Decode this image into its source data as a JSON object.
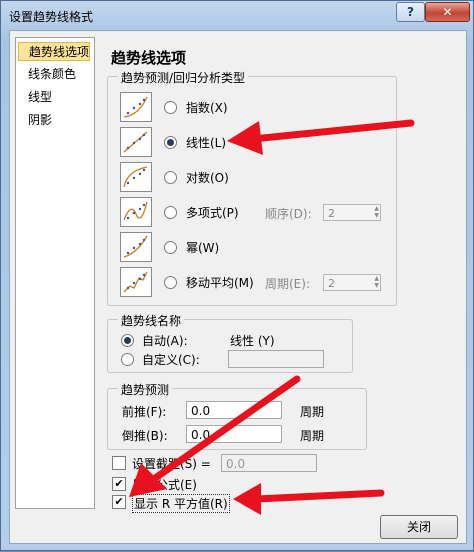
{
  "window": {
    "title": "设置趋势线格式",
    "help_label": "?",
    "close_label": "✕"
  },
  "nav": {
    "items": [
      "趋势线选项",
      "线条颜色",
      "线型",
      "阴影"
    ]
  },
  "panel": {
    "heading": "趋势线选项",
    "type_group": {
      "title": "趋势预测/回归分析类型",
      "options": [
        {
          "label": "指数(X)",
          "selected": false
        },
        {
          "label": "线性(L)",
          "selected": true
        },
        {
          "label": "对数(O)",
          "selected": false
        },
        {
          "label": "多项式(P)",
          "selected": false
        },
        {
          "label": "幂(W)",
          "selected": false
        },
        {
          "label": "移动平均(M)",
          "selected": false
        }
      ],
      "order_label": "顺序(D):",
      "order_value": "2",
      "period_label": "周期(E):",
      "period_value": "2"
    },
    "name_group": {
      "title": "趋势线名称",
      "auto_label": "自动(A):",
      "auto_value": "线性 (Y)",
      "custom_label": "自定义(C):",
      "custom_value": ""
    },
    "forecast_group": {
      "title": "趋势预测",
      "forward_label": "前推(F):",
      "forward_value": "0.0",
      "forward_unit": "周期",
      "backward_label": "倒推(B):",
      "backward_value": "0.0",
      "backward_unit": "周期"
    },
    "intercept": {
      "label": "设置截距(S) =",
      "value": "0.0",
      "checked": false
    },
    "show_equation": {
      "label": "显示公式(E)",
      "checked": true
    },
    "show_r2": {
      "label": "显示 R 平方值(R)",
      "checked": true
    },
    "close_button": "关闭"
  },
  "colors": {
    "arrow": "#e8121e",
    "accent": "#fbe39b"
  }
}
